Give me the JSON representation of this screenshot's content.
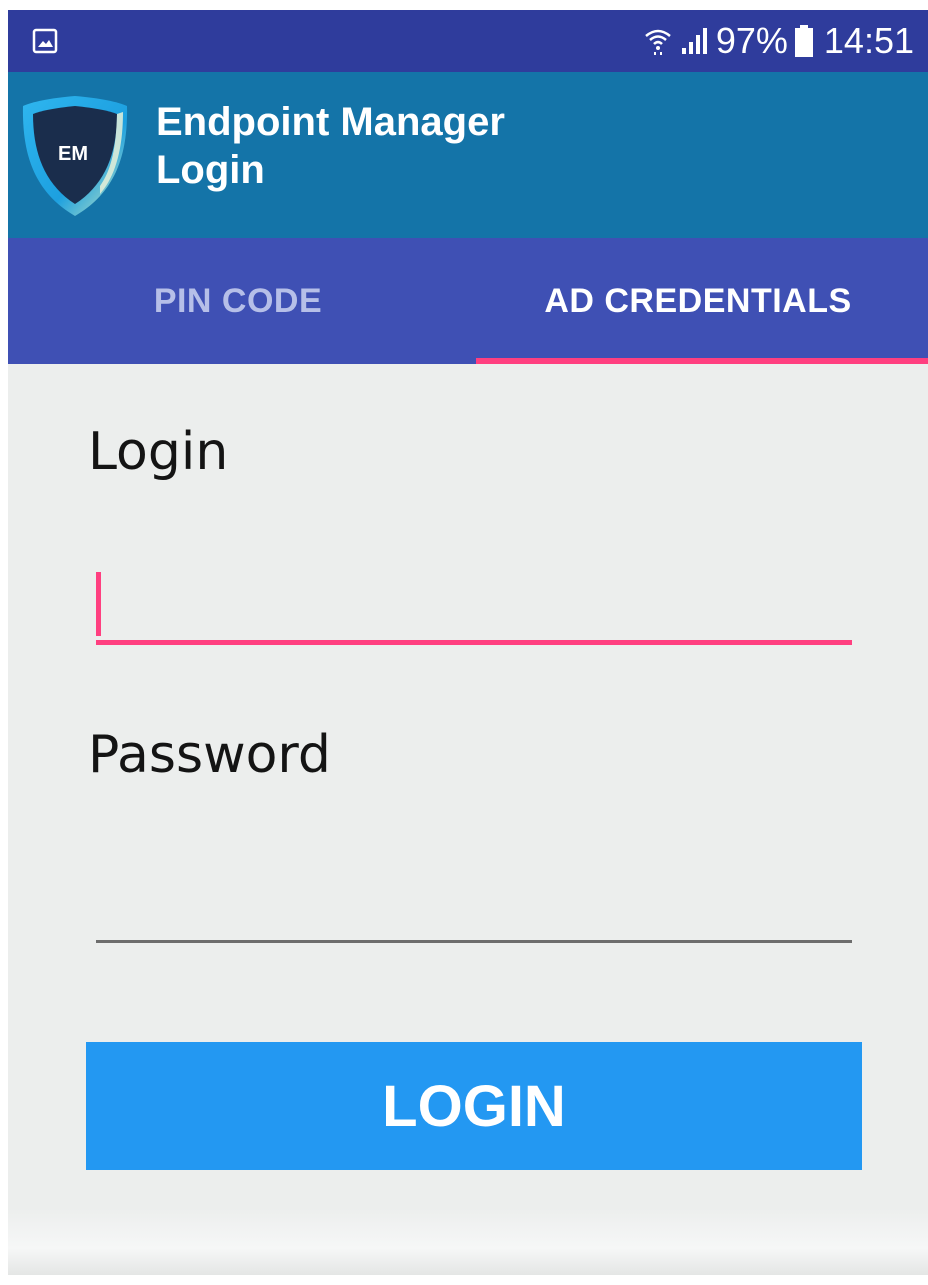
{
  "status_bar": {
    "battery_percent": "97%",
    "time": "14:51",
    "icons": [
      "gallery-icon",
      "wifi-icon",
      "signal-icon",
      "battery-icon"
    ]
  },
  "app_bar": {
    "title_line1": "Endpoint Manager",
    "title_line2": "Login",
    "logo_text": "EM"
  },
  "tabs": [
    {
      "label": "PIN CODE",
      "selected": false
    },
    {
      "label": "AD CREDENTIALS",
      "selected": true
    }
  ],
  "form": {
    "login_label": "Login",
    "login_value": "",
    "password_label": "Password",
    "password_value": "",
    "submit_label": "LOGIN"
  },
  "colors": {
    "status_bar": "#2f3c9c",
    "app_bar": "#1474a8",
    "tab_bar": "#3f50b4",
    "accent": "#ff3f80",
    "button": "#2398f2",
    "background": "#eceeed"
  }
}
